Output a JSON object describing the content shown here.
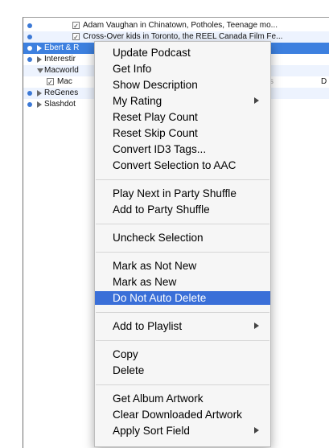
{
  "list": {
    "rows": [
      {
        "text": "Adam Vaughan in Chinatown,  Potholes, Teenage mo..."
      },
      {
        "text": "Cross-Over kids in Toronto, the REEL Canada Film Fe..."
      },
      {
        "text": "Ebert & R"
      },
      {
        "text": "Interestir"
      },
      {
        "text": "Macworld"
      },
      {
        "text": "Mac",
        "extra": "s",
        "extra_right": "D"
      },
      {
        "text": "ReGenes"
      },
      {
        "text": "Slashdot"
      }
    ]
  },
  "context_menu": {
    "items": [
      {
        "label": "Update Podcast"
      },
      {
        "label": "Get Info"
      },
      {
        "label": "Show Description"
      },
      {
        "label": "My Rating",
        "submenu": true
      },
      {
        "label": "Reset Play Count"
      },
      {
        "label": "Reset Skip Count"
      },
      {
        "label": "Convert ID3 Tags..."
      },
      {
        "label": "Convert Selection to AAC"
      },
      {
        "label": "Play Next in Party Shuffle"
      },
      {
        "label": "Add to Party Shuffle"
      },
      {
        "label": "Uncheck Selection"
      },
      {
        "label": "Mark as Not New"
      },
      {
        "label": "Mark as New"
      },
      {
        "label": "Do Not Auto Delete",
        "highlighted": true
      },
      {
        "label": "Add to Playlist",
        "submenu": true
      },
      {
        "label": "Copy"
      },
      {
        "label": "Delete"
      },
      {
        "label": "Get Album Artwork"
      },
      {
        "label": "Clear Downloaded Artwork"
      },
      {
        "label": "Apply Sort Field",
        "submenu": true
      }
    ]
  },
  "colors": {
    "selection": "#3d80df",
    "menu_highlight": "#3a6fd8",
    "alt_row": "#edf3fe"
  }
}
